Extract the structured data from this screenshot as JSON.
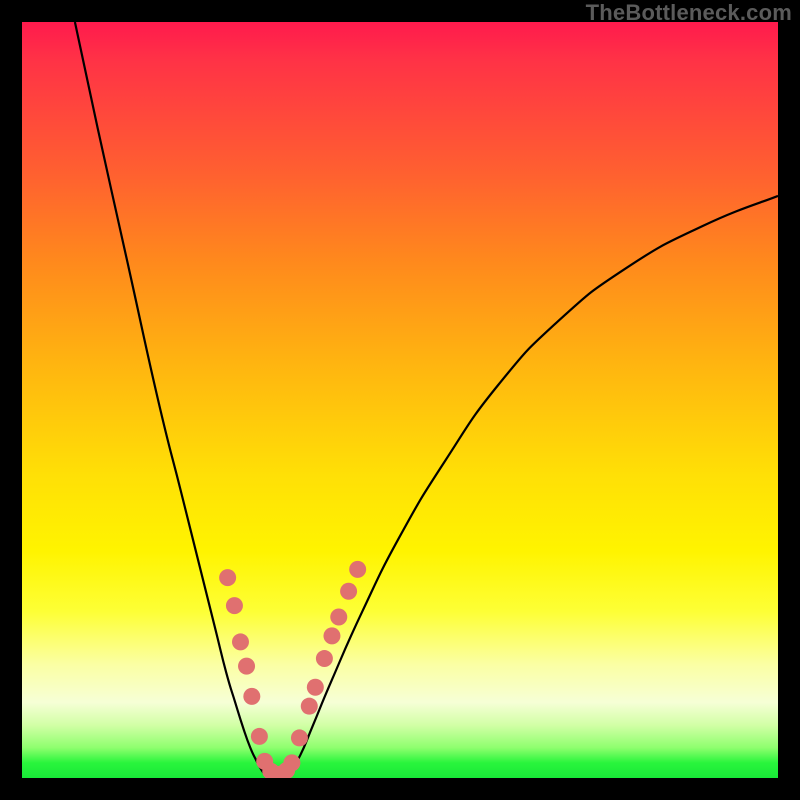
{
  "watermark": "TheBottleneck.com",
  "colors": {
    "background": "#000000",
    "curve": "#000000",
    "dots": "#e07070"
  },
  "chart_data": {
    "type": "line",
    "title": "",
    "xlabel": "",
    "ylabel": "",
    "xlim": [
      0,
      100
    ],
    "ylim": [
      0,
      100
    ],
    "annotations": [],
    "series": [
      {
        "name": "left-curve",
        "x": [
          7,
          10,
          14,
          18,
          21,
          23.5,
          25.5,
          27,
          28.2,
          29.3,
          30.2,
          31,
          31.6,
          32.1,
          32.6
        ],
        "y": [
          100,
          86,
          68,
          50,
          38,
          28,
          20,
          14,
          10,
          6.5,
          4,
          2.3,
          1.2,
          0.5,
          0.15
        ]
      },
      {
        "name": "right-curve",
        "x": [
          34.7,
          35.5,
          36.8,
          38.5,
          41,
          45,
          50,
          56,
          63,
          71,
          80,
          90,
          100
        ],
        "y": [
          0.15,
          1,
          3,
          7,
          13,
          22,
          32,
          42,
          52,
          60.5,
          67.5,
          73,
          77
        ]
      }
    ],
    "dots": [
      {
        "x": 27.2,
        "y": 26.5
      },
      {
        "x": 28.1,
        "y": 22.8
      },
      {
        "x": 28.9,
        "y": 18.0
      },
      {
        "x": 29.7,
        "y": 14.8
      },
      {
        "x": 30.4,
        "y": 10.8
      },
      {
        "x": 31.4,
        "y": 5.5
      },
      {
        "x": 32.1,
        "y": 2.2
      },
      {
        "x": 32.9,
        "y": 0.9
      },
      {
        "x": 33.6,
        "y": 0.5
      },
      {
        "x": 34.2,
        "y": 0.5
      },
      {
        "x": 35.0,
        "y": 1.0
      },
      {
        "x": 35.7,
        "y": 2.0
      },
      {
        "x": 36.7,
        "y": 5.3
      },
      {
        "x": 38.0,
        "y": 9.5
      },
      {
        "x": 38.8,
        "y": 12.0
      },
      {
        "x": 40.0,
        "y": 15.8
      },
      {
        "x": 41.0,
        "y": 18.8
      },
      {
        "x": 41.9,
        "y": 21.3
      },
      {
        "x": 43.2,
        "y": 24.7
      },
      {
        "x": 44.4,
        "y": 27.6
      }
    ]
  }
}
